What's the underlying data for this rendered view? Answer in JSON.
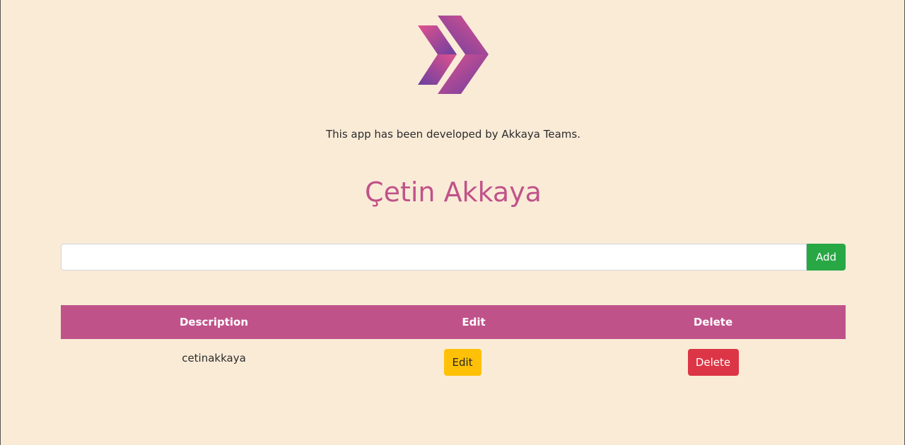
{
  "header": {
    "logo_icon": "double-chevron-logo-icon",
    "credit": "This app has been developed by Akkaya Teams.",
    "title": "Çetin Akkaya"
  },
  "form": {
    "input_value": "",
    "input_placeholder": "",
    "add_label": "Add"
  },
  "table": {
    "headers": [
      "Description",
      "Edit",
      "Delete"
    ],
    "rows": [
      {
        "description": "cetinakkaya",
        "edit_label": "Edit",
        "delete_label": "Delete"
      }
    ]
  },
  "colors": {
    "background": "#faebd7",
    "accent": "#c0528a",
    "add": "#28a745",
    "edit": "#ffc107",
    "delete": "#dc3545"
  }
}
